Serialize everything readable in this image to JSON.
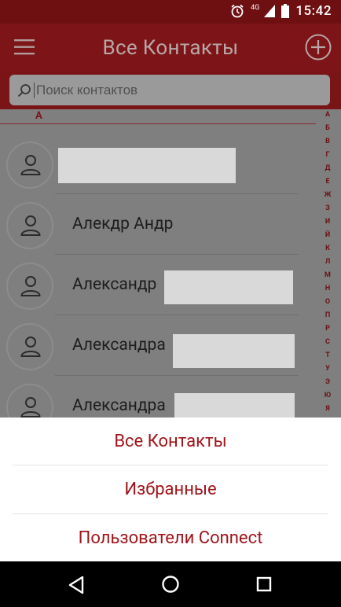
{
  "status_bar": {
    "time": "15:42",
    "network": "4G"
  },
  "app_bar": {
    "title": "Все Контакты"
  },
  "search": {
    "placeholder": "Поиск контактов"
  },
  "section": {
    "letter": "А"
  },
  "contacts": [
    {
      "name": ""
    },
    {
      "name": "Алекдр Андр"
    },
    {
      "name": "Александр"
    },
    {
      "name": "Александра"
    },
    {
      "name": "Александра"
    }
  ],
  "alphabet": [
    "А",
    "Б",
    "В",
    "Г",
    "Д",
    "Е",
    "Ж",
    "З",
    "И",
    "Й",
    "К",
    "Л",
    "М",
    "Н",
    "О",
    "П",
    "Р",
    "С",
    "Т",
    "У",
    "Э",
    "Ю",
    "Я"
  ],
  "sheet": {
    "items": [
      "Все Контакты",
      "Избранные",
      "Пользователи Connect"
    ]
  },
  "colors": {
    "brand": "#c0171d",
    "accent_text": "#a0141a"
  },
  "icons": {
    "menu": "hamburger-icon",
    "add": "plus-circle-icon",
    "search": "search-icon",
    "avatar": "person-icon",
    "back": "triangle-back-icon",
    "home": "circle-home-icon",
    "recent": "square-recent-icon"
  }
}
